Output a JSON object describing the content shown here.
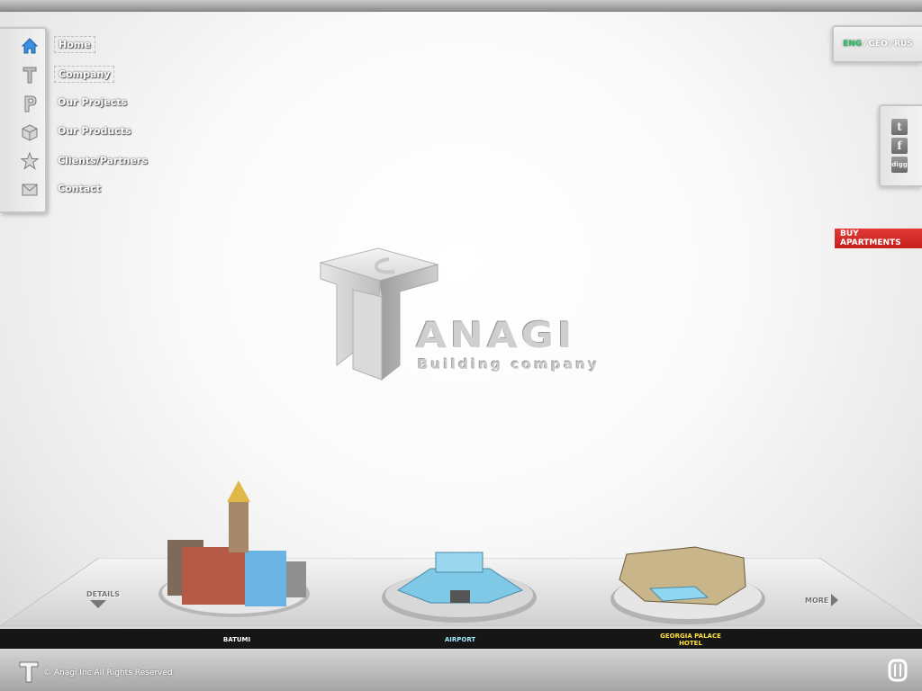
{
  "nav": {
    "items": [
      {
        "label": "Home",
        "icon": "home-icon"
      },
      {
        "label": "Company",
        "icon": "company-icon"
      },
      {
        "label": "Our Projects",
        "icon": "projects-icon"
      },
      {
        "label": "Our Products",
        "icon": "products-icon"
      },
      {
        "label": "Clients/Partners",
        "icon": "star-icon"
      },
      {
        "label": "Contact",
        "icon": "envelope-icon"
      }
    ]
  },
  "lang": {
    "eng": "ENG",
    "geo": "GEO",
    "rus": "RUS",
    "sep": "/"
  },
  "social": {
    "twitter": "t",
    "facebook": "f",
    "digg": "digg"
  },
  "buy": {
    "label": "BUY APARTMENTS"
  },
  "logo": {
    "word": "ANAGI",
    "sub": "Building company"
  },
  "projects": {
    "details": "DETAILS",
    "more": "MORE",
    "captions": [
      {
        "lines": [
          "BATUMI"
        ]
      },
      {
        "lines": [
          "AIRPORT"
        ]
      },
      {
        "lines": [
          "GEORGIA PALACE",
          "HOTEL"
        ]
      }
    ]
  },
  "footer": {
    "copyright": "© Anagi.Inc All Rights Reserved"
  },
  "colors": {
    "accent_red": "#d42d29",
    "lang_active": "#29c26a"
  }
}
